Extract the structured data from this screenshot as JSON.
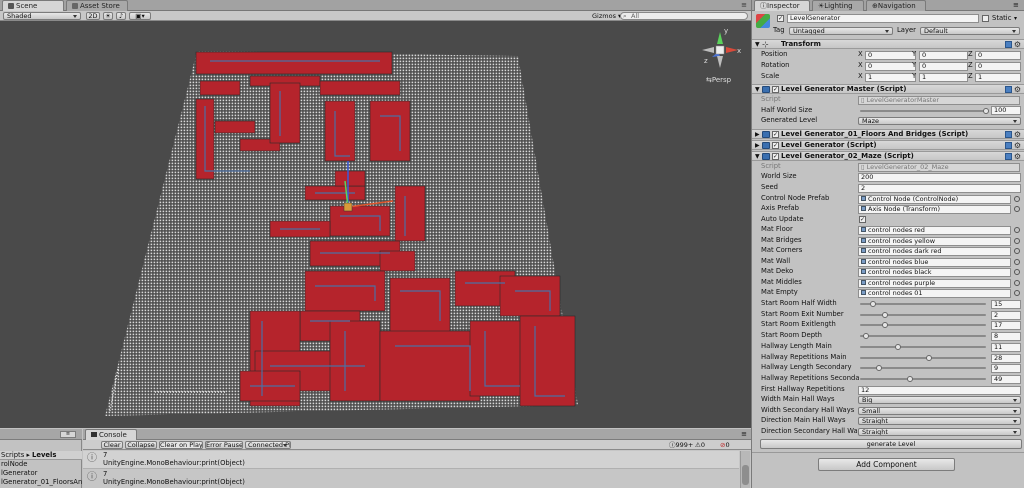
{
  "scene": {
    "tabs": [
      "Scene",
      "Asset Store"
    ],
    "toolbar": {
      "shading": "Shaded",
      "mode_2d": "2D",
      "gizmos": "Gizmos",
      "search_placeholder": "All"
    },
    "view_label": "Persp",
    "axes": {
      "x": "x",
      "y": "y",
      "z": "z"
    }
  },
  "bottom_left": {
    "header_scripts": "Scripts",
    "header_sep": "▸",
    "header_levels": "Levels",
    "items": [
      "rolNode",
      "lGenerator",
      "lGenerator_01_FloorsAn"
    ]
  },
  "console": {
    "tab": "Console",
    "buttons": [
      "Clear",
      "Collapse",
      "Clear on Play",
      "Error Pause",
      "Connected Players"
    ],
    "count": "999+",
    "counts": [
      "0",
      "0"
    ],
    "entries": [
      {
        "line1": "7",
        "line2": "UnityEngine.MonoBehaviour:print(Object)"
      },
      {
        "line1": "7",
        "line2": "UnityEngine.MonoBehaviour:print(Object)"
      }
    ]
  },
  "inspector": {
    "tabs": [
      "Inspector",
      "Lighting",
      "Navigation"
    ],
    "object_name": "LevelGenerator",
    "static_label": "Static",
    "tag_label": "Tag",
    "tag_value": "Untagged",
    "layer_label": "Layer",
    "layer_value": "Default",
    "transform": {
      "title": "Transform",
      "rows": [
        {
          "label": "Position",
          "x": "0",
          "y": "0",
          "z": "0"
        },
        {
          "label": "Rotation",
          "x": "0",
          "y": "0",
          "z": "0"
        },
        {
          "label": "Scale",
          "x": "1",
          "y": "1",
          "z": "1"
        }
      ],
      "axis_x": "X",
      "axis_y": "Y",
      "axis_z": "Z"
    },
    "master": {
      "title": "Level Generator Master (Script)",
      "script_label": "Script",
      "script_value": "LevelGeneratorMaster",
      "half_world_label": "Half World Size",
      "half_world_value": "100",
      "half_world_fraction": 1.0,
      "generated_label": "Generated Level",
      "generated_value": "Maze"
    },
    "floors_title": "Level Generator_01_Floors And Bridges (Script)",
    "generic_title": "Level Generator (Script)",
    "maze": {
      "title": "Level Generator_02_Maze (Script)",
      "script_label": "Script",
      "script_value": "LevelGenerator_02_Maze",
      "world_size_label": "World Size",
      "world_size_value": "200",
      "seed_label": "Seed",
      "seed_value": "2",
      "objects": [
        {
          "label": "Control Node Prefab",
          "value": "Control Node (ControlNode)"
        },
        {
          "label": "Axis Prefab",
          "value": "Axis Node (Transform)"
        }
      ],
      "auto_update_label": "Auto Update",
      "auto_update_check": "✓",
      "materials": [
        {
          "label": "Mat Floor",
          "value": "control nodes red"
        },
        {
          "label": "Mat Bridges",
          "value": "control nodes yellow"
        },
        {
          "label": "Mat Corners",
          "value": "control nodes dark red"
        },
        {
          "label": "Mat Wall",
          "value": "control nodes blue"
        },
        {
          "label": "Mat Deko",
          "value": "control nodes black"
        },
        {
          "label": "Mat Middles",
          "value": "control nodes purple"
        },
        {
          "label": "Mat Empty",
          "value": "control nodes 01"
        }
      ],
      "sliders": [
        {
          "label": "Start Room Half Width",
          "value": "15",
          "fraction": 0.1
        },
        {
          "label": "Start Room Exit Number",
          "value": "2",
          "fraction": 0.2
        },
        {
          "label": "Start Room Exitlength",
          "value": "17",
          "fraction": 0.2
        },
        {
          "label": "Start Room Depth",
          "value": "8",
          "fraction": 0.05
        },
        {
          "label": "Hallway Length Main",
          "value": "11",
          "fraction": 0.3
        },
        {
          "label": "Hallway Repetitions Main",
          "value": "28",
          "fraction": 0.55
        },
        {
          "label": "Hallway Length Secondary",
          "value": "9",
          "fraction": 0.15
        },
        {
          "label": "Hallway Repetitions Seconda",
          "value": "49",
          "fraction": 0.4
        }
      ],
      "first_hallway_label": "First Hallway Repetitions",
      "first_hallway_value": "12",
      "dropdowns": [
        {
          "label": "Width Main Hall Ways",
          "value": "Big"
        },
        {
          "label": "Width Secondary Hall Ways",
          "value": "Small"
        },
        {
          "label": "Direction Main Hall Ways",
          "value": "Straight"
        },
        {
          "label": "Direction Secondary Hall Wa",
          "value": "Straight"
        }
      ],
      "generate_label": "generate Level"
    },
    "add_component_label": "Add Component"
  }
}
